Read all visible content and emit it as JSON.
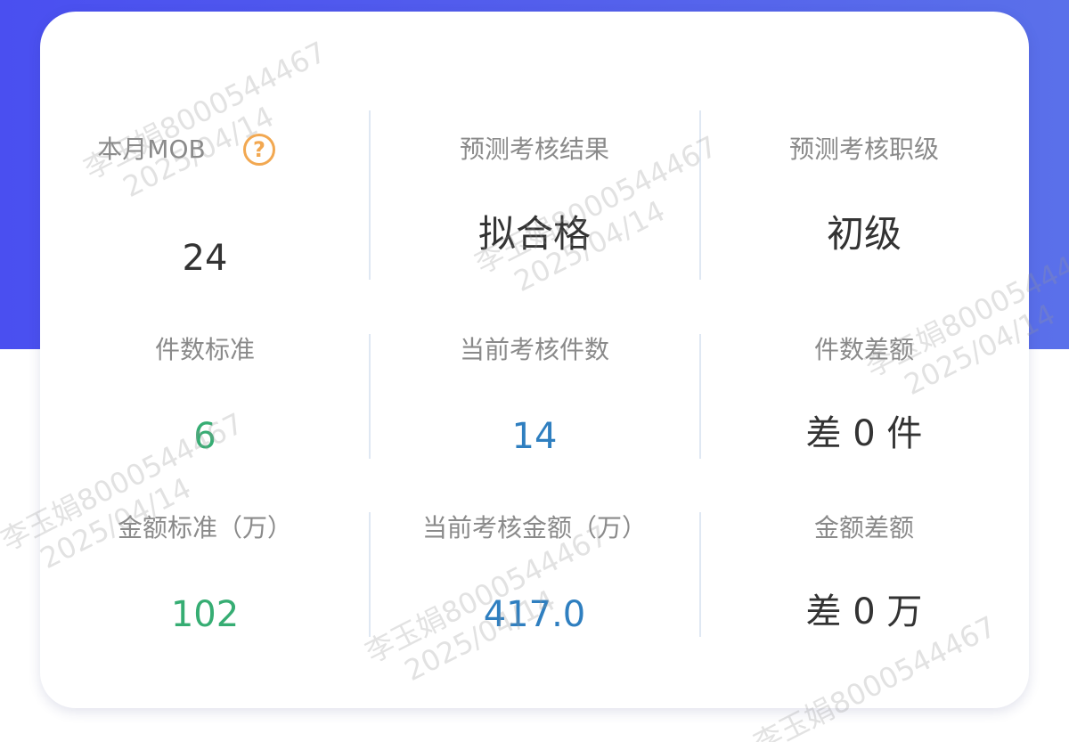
{
  "stats": {
    "mob": {
      "label": "本月MOB",
      "value": "24"
    },
    "predicted_result": {
      "label": "预测考核结果",
      "value": "拟合格"
    },
    "predicted_level": {
      "label": "预测考核职级",
      "value": "初级"
    },
    "count_standard": {
      "label": "件数标准",
      "value": "6"
    },
    "current_count": {
      "label": "当前考核件数",
      "value": "14"
    },
    "count_gap": {
      "label": "件数差额",
      "value": "差 0 件"
    },
    "amount_standard": {
      "label": "金额标准（万）",
      "value": "102"
    },
    "current_amount": {
      "label": "当前考核金额（万）",
      "value": "417.0"
    },
    "amount_gap": {
      "label": "金额差额",
      "value": "差 0 万"
    }
  },
  "help_icon_glyph": "?",
  "watermark": {
    "name_id": "李玉娟8000544467",
    "date": "2025/04/14"
  },
  "colors": {
    "header_bg": "#4a4ff0",
    "green_value": "#36ad73",
    "blue_value": "#2f7fc0",
    "help_icon": "#f2a851",
    "label_gray": "#8a8a8a"
  }
}
